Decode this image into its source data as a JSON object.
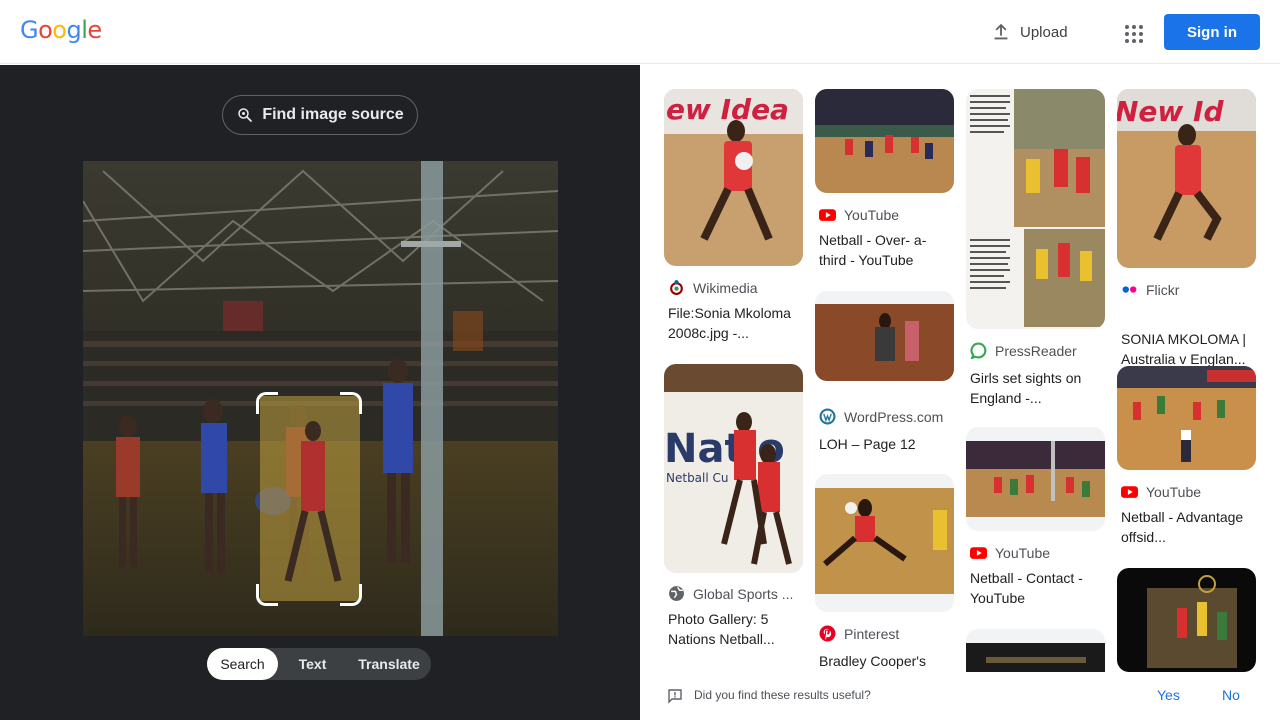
{
  "header": {
    "logo": [
      "G",
      "o",
      "o",
      "g",
      "l",
      "e"
    ],
    "logo_colors": [
      "#4285F4",
      "#EA4335",
      "#FBBC05",
      "#4285F4",
      "#34A853",
      "#EA4335"
    ],
    "upload_label": "Upload",
    "signin_label": "Sign in"
  },
  "lens": {
    "find_source_label": "Find image source",
    "tabs": [
      {
        "label": "Search",
        "active": true
      },
      {
        "label": "Text",
        "active": false
      },
      {
        "label": "Translate",
        "active": false
      }
    ]
  },
  "results": [
    {
      "source": "Wikimedia",
      "title": "File:Sonia Mkoloma 2008c.jpg -...",
      "favicon": "wikimedia-icon"
    },
    {
      "source": "Global Sports ...",
      "title": "Photo Gallery: 5 Nations Netball...",
      "favicon": "globe-icon"
    },
    {
      "source": "YouTube",
      "title": "Netball - Over- a-third - YouTube",
      "favicon": "youtube-icon"
    },
    {
      "source": "WordPress.com",
      "title": "LOH – Page 12",
      "favicon": "wordpress-icon"
    },
    {
      "source": "Pinterest",
      "title": "Bradley Cooper's",
      "favicon": "pinterest-icon"
    },
    {
      "source": "PressReader",
      "title": "Girls set sights on England -...",
      "favicon": "pressreader-icon"
    },
    {
      "source": "YouTube",
      "title": "Netball - Contact - YouTube",
      "favicon": "youtube-icon"
    },
    {
      "source": "Flickr",
      "title": "SONIA MKOLOMA | Australia v Englan...",
      "favicon": "flickr-icon"
    },
    {
      "source": "YouTube",
      "title": "Netball - Advantage offsid...",
      "favicon": "youtube-icon"
    }
  ],
  "thumb_text": {
    "new_idea": "ew Idea",
    "new_idea_2": "New Id",
    "nations": "Natio",
    "netball_cup": "Netball Cu"
  },
  "feedback": {
    "question": "Did you find these results useful?",
    "yes": "Yes",
    "no": "No"
  },
  "colors": {
    "accent": "#1a73e8",
    "dark_panel": "#202124",
    "youtube": "#FF0000",
    "pinterest": "#E60023",
    "wordpress": "#21759B",
    "pressreader": "#34A853",
    "flickr_blue": "#0063DC",
    "flickr_pink": "#FF0084"
  }
}
